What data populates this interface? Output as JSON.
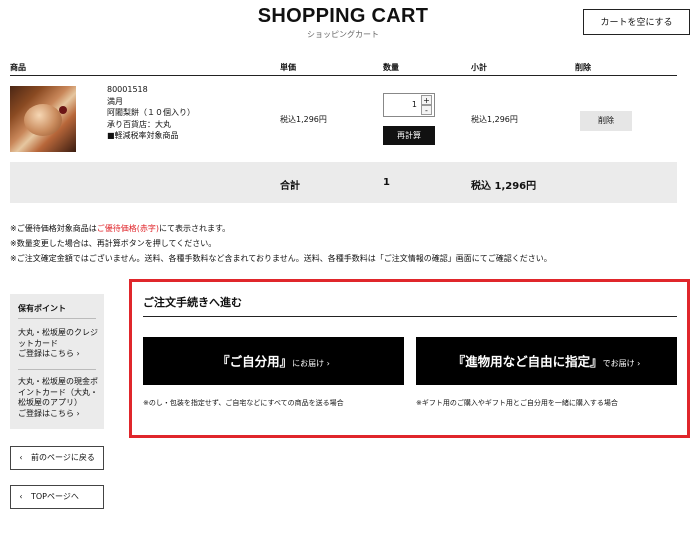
{
  "header": {
    "title": "SHOPPING CART",
    "subtitle": "ショッピングカート",
    "empty_cart_label": "カートを空にする"
  },
  "table": {
    "headers": {
      "product": "商品",
      "unit_price": "単価",
      "quantity": "数量",
      "subtotal": "小計",
      "delete": "削除"
    },
    "item": {
      "code": "80001518",
      "name": "満月",
      "description": "阿闍梨餅（１０個入り）",
      "store": "承り百貨店：大丸",
      "tax_note": "■軽減税率対象商品",
      "unit_price": "税込1,296円",
      "quantity": "1",
      "qty_up": "+",
      "qty_down": "-",
      "recalc_label": "再計算",
      "subtotal": "税込1,296円",
      "delete_label": "削除"
    },
    "total": {
      "label": "合計",
      "quantity": "1",
      "amount": "税込 1,296円"
    }
  },
  "notes": {
    "line1_a": "※ご優待価格対象商品は",
    "line1_red": "ご優待価格(赤字)",
    "line1_b": "にて表示されます。",
    "line2": "※数量変更した場合は、再計算ボタンを押してください。",
    "line3": "※ご注文確定金額ではございません。送料、各種手数料など含まれておりません。送料、各種手数料は「ご注文情報の確認」画面にてご確認ください。"
  },
  "sidebar": {
    "heading": "保有ポイント",
    "link1": [
      "大丸・松坂屋のクレジ",
      "ットカード",
      "ご登録はこちら ›"
    ],
    "link2": [
      "大丸・松坂屋の現金ポ",
      "イントカード（大丸・",
      "松坂屋のアプリ）",
      "ご登録はこちら ›"
    ]
  },
  "nav": {
    "back_label": "前のページに戻る",
    "top_label": "TOPページへ"
  },
  "procedure": {
    "title": "ご注文手続きへ進む",
    "self_big": "『ご自分用』",
    "self_small": "にお届け ›",
    "self_caption": "※のし・包装を指定せず、ご自宅などにすべての商品を送る場合",
    "gift_big": "『進物用など自由に指定』",
    "gift_small": "でお届け ›",
    "gift_caption": "※ギフト用のご購入やギフト用とご自分用を一緒に購入する場合"
  },
  "colors": {
    "accent_red": "#e0262b",
    "black": "#000000",
    "band_gray": "#ebebeb"
  }
}
